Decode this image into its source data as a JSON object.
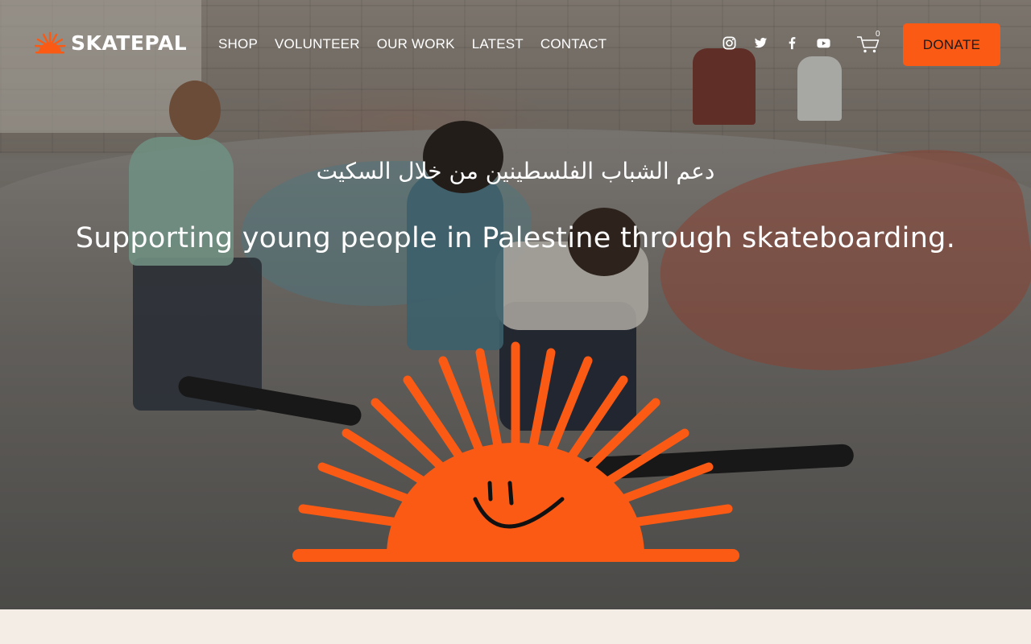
{
  "brand": {
    "name": "SKATEPAL",
    "accent_color": "#fa5a14"
  },
  "nav": {
    "items": [
      {
        "label": "SHOP"
      },
      {
        "label": "VOLUNTEER"
      },
      {
        "label": "OUR WORK"
      },
      {
        "label": "LATEST"
      },
      {
        "label": "CONTACT"
      }
    ]
  },
  "social": {
    "icons": [
      "instagram-icon",
      "twitter-icon",
      "facebook-icon",
      "youtube-icon"
    ]
  },
  "cart": {
    "count": "0",
    "icon": "cart-icon"
  },
  "donate": {
    "label": "DONATE"
  },
  "hero": {
    "arabic_tagline": "دعم الشباب الفلسطينين من خلال السكيت",
    "tagline": "Supporting young people in Palestine through skateboarding.",
    "sun_icon": "smiling-sun-icon"
  }
}
